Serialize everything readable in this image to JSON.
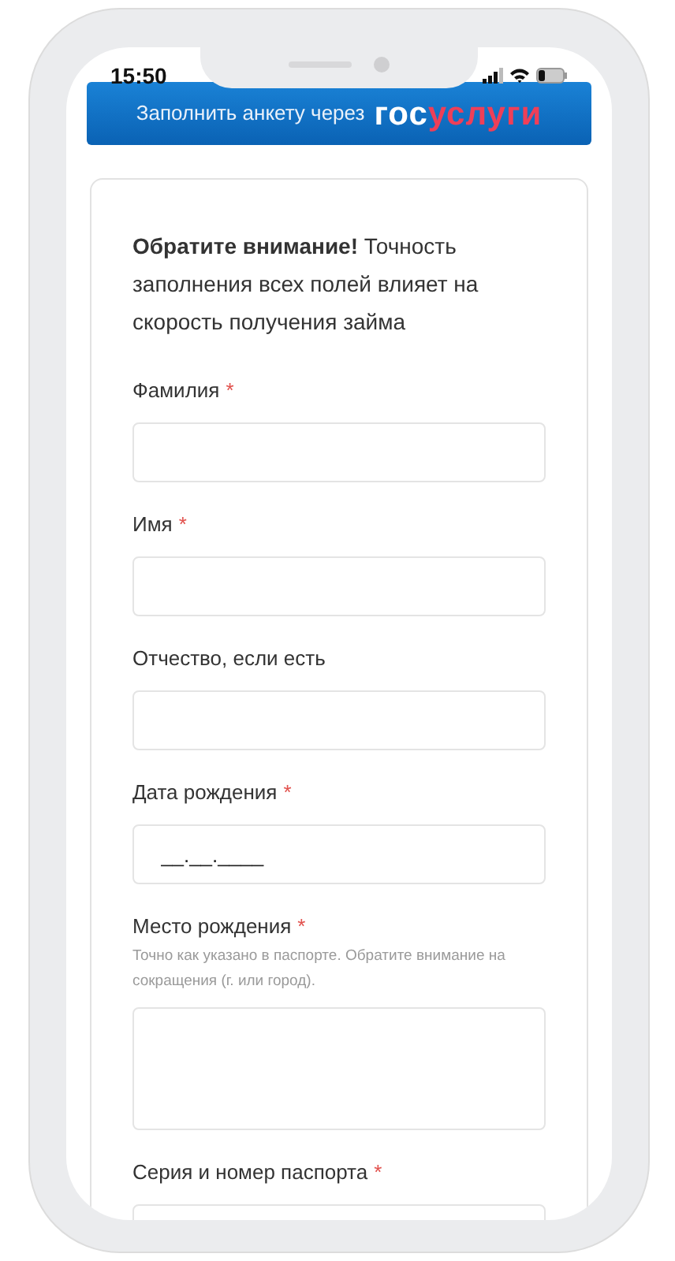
{
  "status_bar": {
    "time": "15:50"
  },
  "banner": {
    "text": "Заполнить анкету через",
    "logo_part_1": "гос",
    "logo_part_2": "услуги"
  },
  "notice": "**Обратите внимание!** Точность заполнения всех полей влияет на скорость получения займа",
  "fields": [
    {
      "label": "Фамилия",
      "required_mark": "*",
      "kind": "text"
    },
    {
      "label": "Имя",
      "required_mark": "*",
      "kind": "text"
    },
    {
      "label": "Отчество, если есть",
      "kind": "text"
    },
    {
      "label": "Дата рождения",
      "required_mark": "*",
      "kind": "text",
      "placeholder": "__.__.____"
    },
    {
      "label": "Место рождения",
      "required_mark": "*",
      "kind": "textarea",
      "hint": "Точно как указано в паспорте. Обратите внимание на сокращения (г. или город)."
    },
    {
      "label": "Серия и номер паспорта",
      "required_mark": "*",
      "kind": "text"
    }
  ]
}
